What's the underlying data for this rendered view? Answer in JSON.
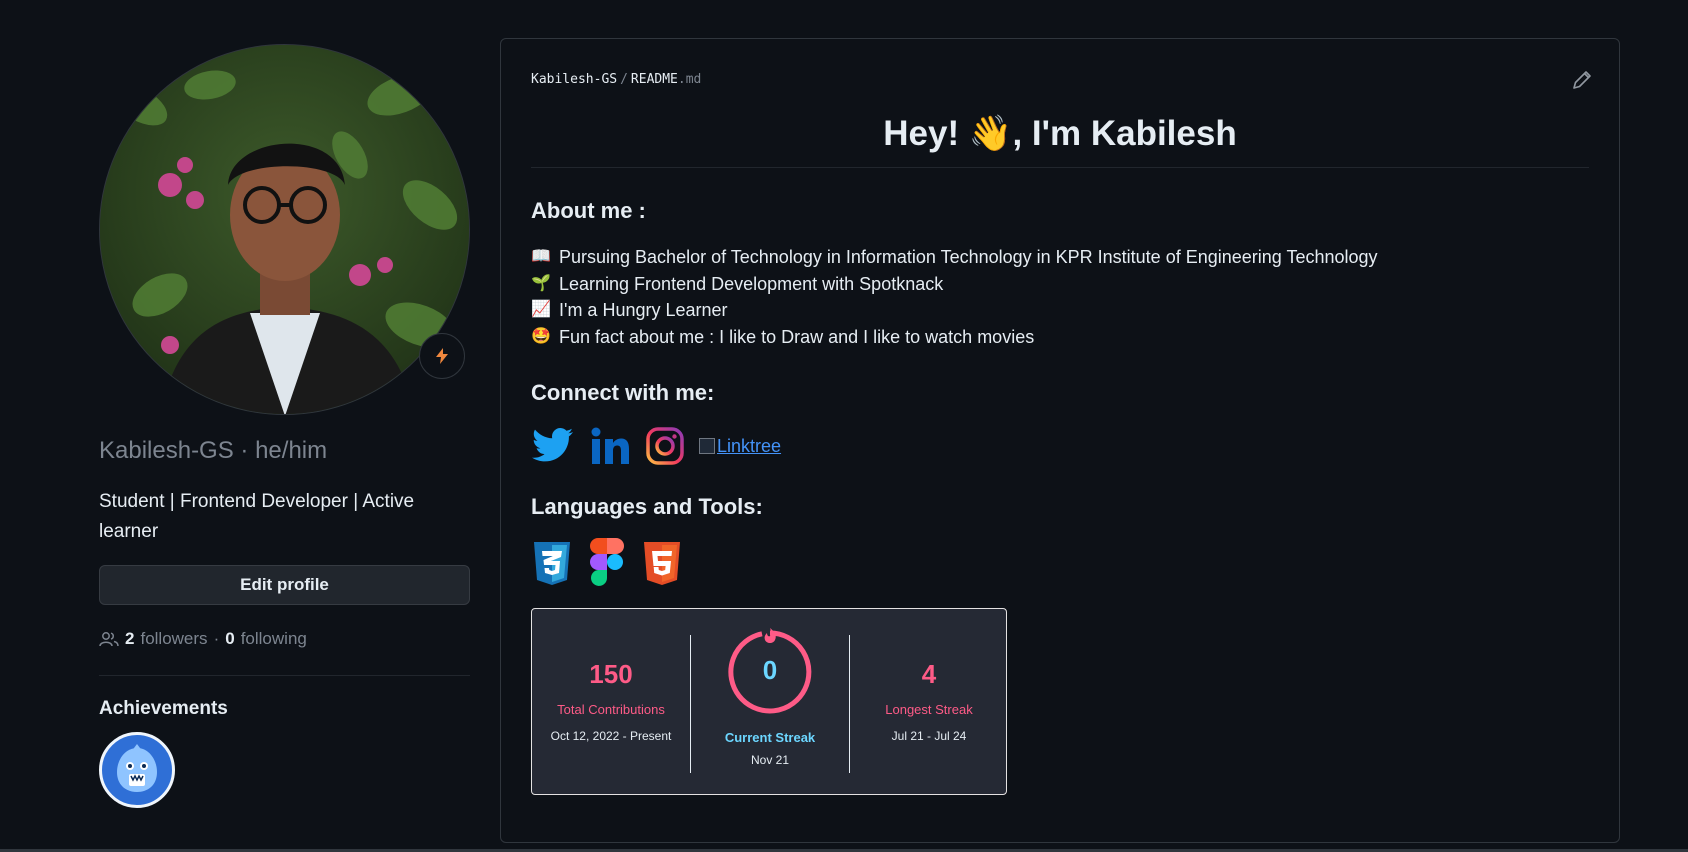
{
  "sidebar": {
    "username": "Kabilesh-GS",
    "pronoun_sep": "·",
    "pronouns": "he/him",
    "bio": "Student | Frontend Developer | Active learner",
    "edit_label": "Edit profile",
    "followers_count": "2",
    "followers_label": "followers",
    "dot": "·",
    "following_count": "0",
    "following_label": "following",
    "achievements_title": "Achievements"
  },
  "readme": {
    "owner": "Kabilesh-GS",
    "separator": "/",
    "file_name": "README",
    "file_ext": ".md",
    "heading_prefix": "Hey!",
    "heading_emoji": "👋",
    "heading_suffix": ", I'm Kabilesh",
    "about_title": "About me :",
    "about_items": [
      {
        "emoji": "📖",
        "text": "Pursuing Bachelor of Technology in Information Technology in KPR Institute of Engineering Technology"
      },
      {
        "emoji": "🌱",
        "text": "Learning Frontend Development with Spotknack"
      },
      {
        "emoji": "📈",
        "text": "I'm a Hungry Learner"
      },
      {
        "emoji": "🤩",
        "text": "Fun fact about me : I like to Draw and I like to watch movies"
      }
    ],
    "connect_title": "Connect with me:",
    "linktree_alt": "Linktree",
    "languages_title": "Languages and Tools:",
    "stats": {
      "total": "150",
      "total_label": "Total Contributions",
      "total_range": "Oct 12, 2022 - Present",
      "current": "0",
      "current_label": "Current Streak",
      "current_date": "Nov 21",
      "longest": "4",
      "longest_label": "Longest Streak",
      "longest_range": "Jul 21 - Jul 24"
    }
  },
  "colors": {
    "background": "#0d1117",
    "accent_pink": "#fe5b87",
    "accent_cyan": "#6cd6ff",
    "link": "#4493f8",
    "twitter": "#1da1f2",
    "linkedin": "#0a66c2"
  },
  "icons": [
    "zap-icon",
    "people-icon",
    "pencil-icon",
    "twitter-icon",
    "linkedin-icon",
    "instagram-icon",
    "css3-icon",
    "figma-icon",
    "html5-icon",
    "flame-icon",
    "shark-badge-icon"
  ]
}
